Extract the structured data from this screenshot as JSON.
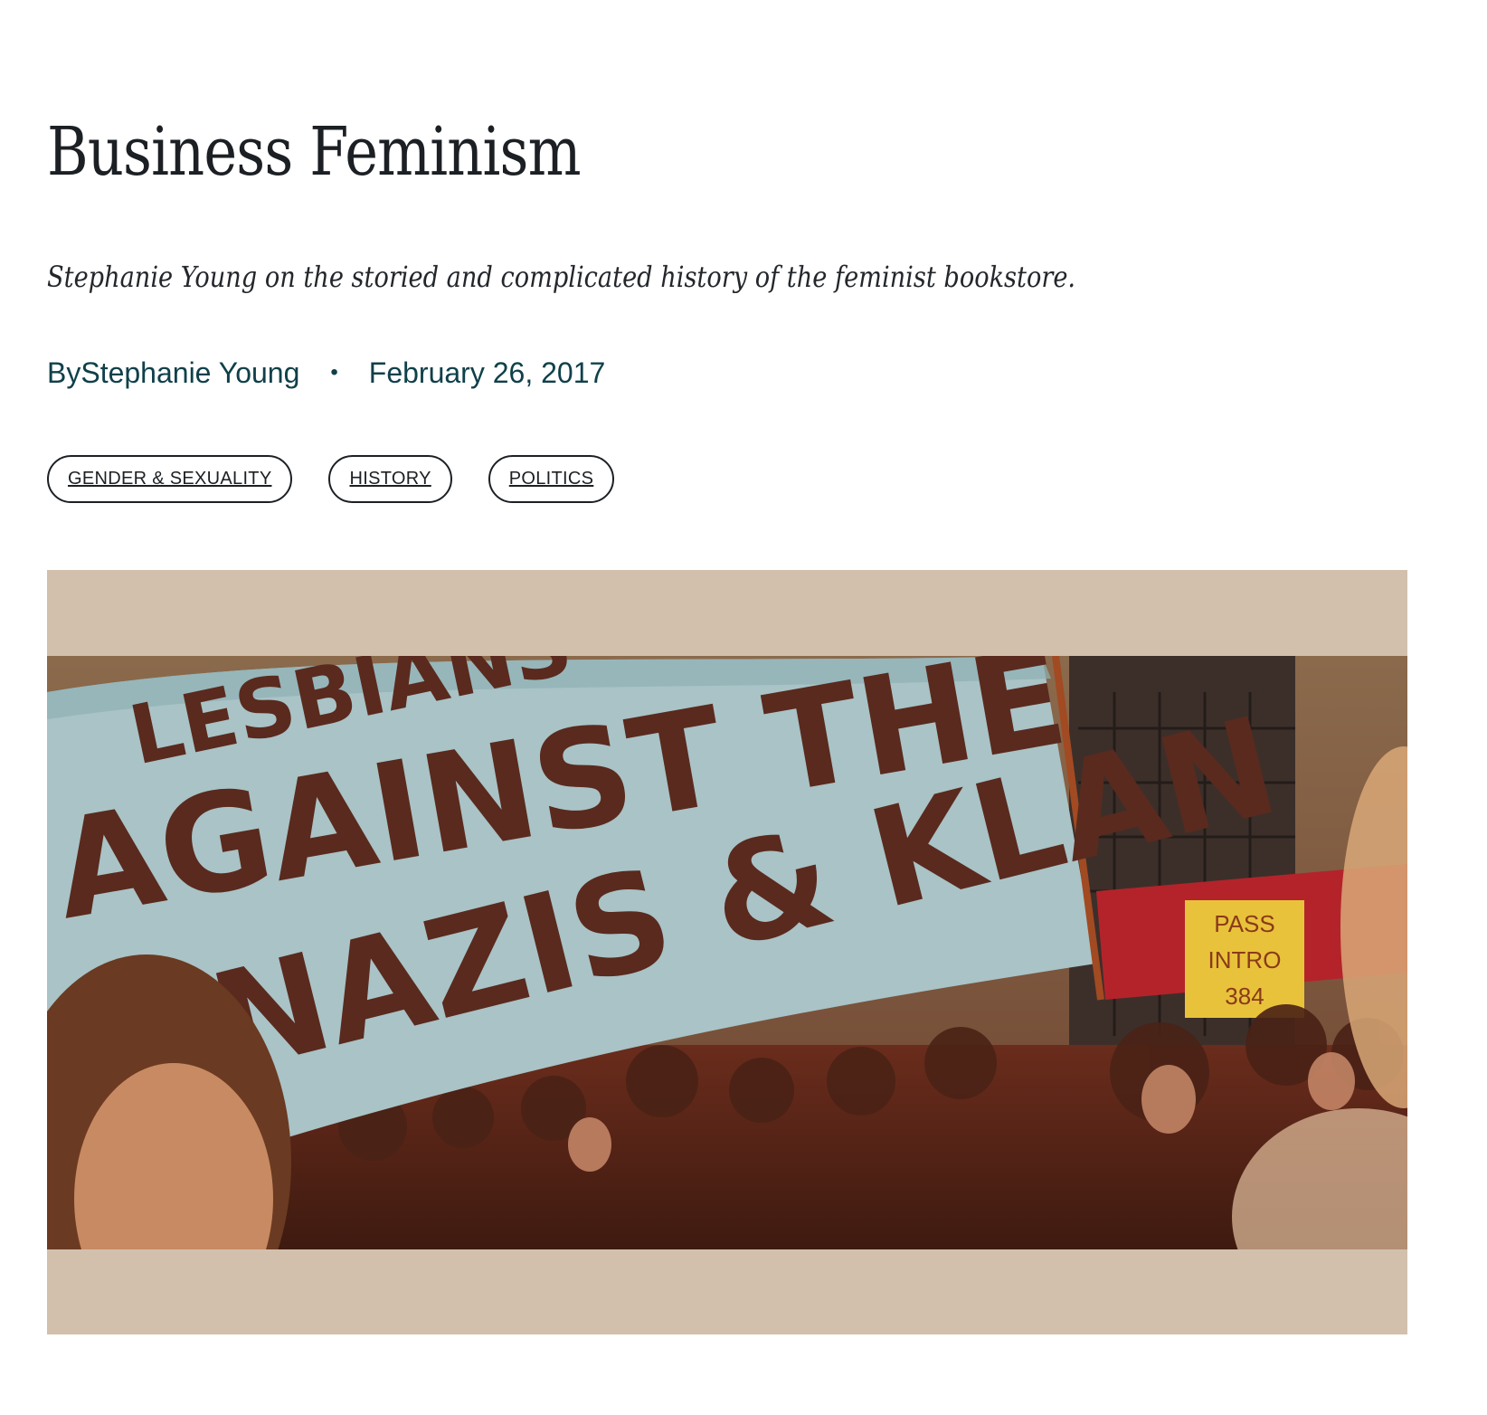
{
  "article": {
    "title": "Business Feminism",
    "dek": "Stephanie Young on the storied and complicated history of the feminist bookstore.",
    "byline": {
      "prefix": "By ",
      "author": "Stephanie Young",
      "separator": "•",
      "date": "February 26, 2017"
    },
    "tags": [
      "GENDER & SEXUALITY",
      "HISTORY",
      "POLITICS"
    ]
  },
  "hero": {
    "banner_text": {
      "line1": "LESBIANS",
      "line2": "AGAINST THE",
      "line3": "NAZIS & KLAN"
    },
    "sign_text": {
      "line1": "PASS",
      "line2": "INTRO",
      "line3": "384"
    },
    "colors": {
      "letterbox": "#d2c0ad",
      "banner": "#a9c3c6",
      "banner_letters": "#5a2a1e",
      "sign": "#e8c23a"
    }
  }
}
